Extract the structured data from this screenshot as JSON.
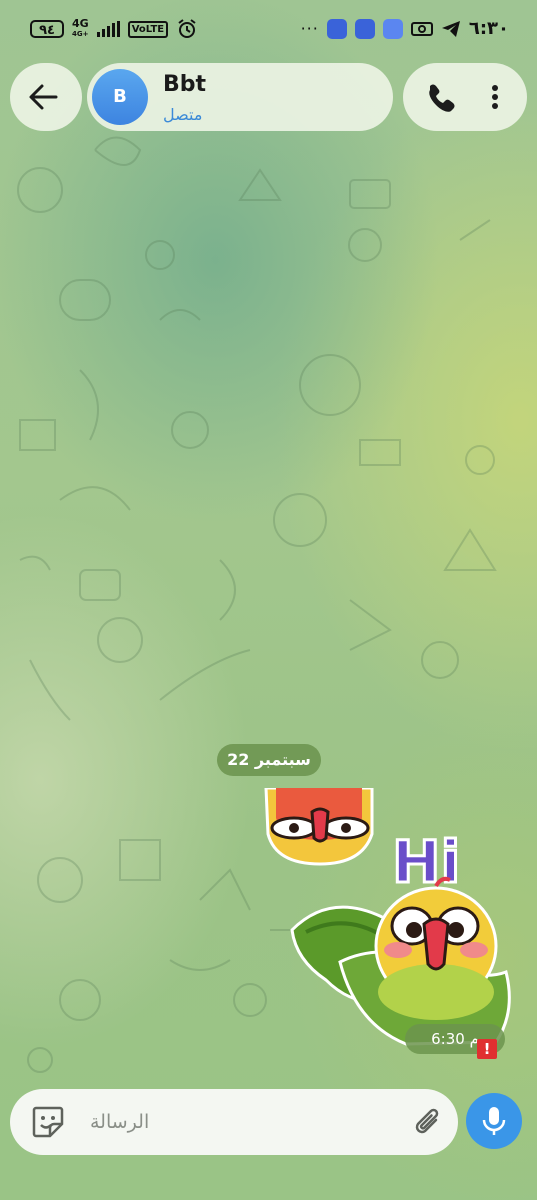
{
  "status_bar": {
    "battery": "٩٤",
    "network": "4G",
    "network_sub": "4G+",
    "volte": "VoLTE",
    "more": "···",
    "time": "٦:٣٠"
  },
  "header": {
    "avatar_letter": "B",
    "chat_name": "Bbt",
    "chat_status": "متصل"
  },
  "messages": {
    "date_badge": "22 سبتمبر",
    "sticker_text": "Hi",
    "sent_time": "6:30 م",
    "error_mark": "!"
  },
  "composer": {
    "placeholder": "الرسالة"
  },
  "colors": {
    "accent": "#3a96e8",
    "online": "#3b8ad8",
    "error": "#e03030",
    "badge_bg": "#6c944e"
  }
}
